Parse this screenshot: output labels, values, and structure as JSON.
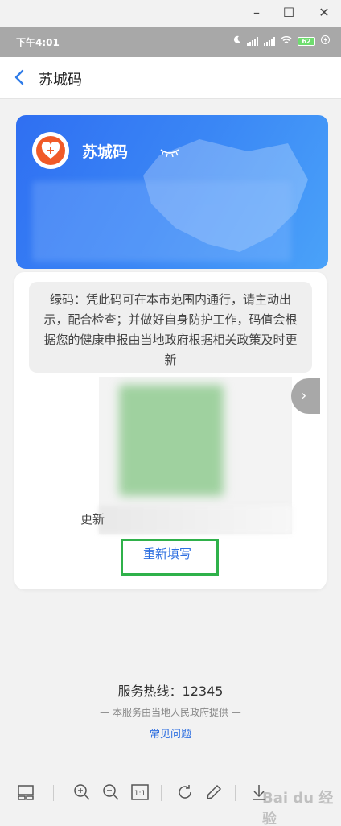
{
  "window": {
    "minimize_glyph": "–",
    "maximize_glyph": "☐",
    "close_glyph": "✕"
  },
  "status_bar": {
    "time": "下午4:01",
    "battery": "62"
  },
  "header": {
    "title": "苏城码",
    "back_icon": "back-chevron-icon"
  },
  "blue_card": {
    "title": "苏城码"
  },
  "notice": {
    "text": "绿码：凭此码可在本市范围内通行，请主动出示，配合检查；并做好自身防护工作，码值会根据您的健康申报由当地政府根据相关政策及时更新"
  },
  "qr_section": {
    "update_prefix": "更新",
    "next_glyph": "›"
  },
  "actions": {
    "refill_label": "重新填写"
  },
  "footer": {
    "hotline": "服务热线：12345",
    "provided_by": "— 本服务由当地人民政府提供 —",
    "faq": "常见问题"
  },
  "colors": {
    "blue_start": "#2f6ff2",
    "blue_end": "#4aa2f9",
    "accent_link": "#2e6fe0",
    "highlight_green": "#2fb14a",
    "logo_orange": "#f05a28"
  },
  "watermark": {
    "text": "Bai du 经验"
  },
  "toolbar": {
    "icons": [
      "layout-icon",
      "zoom-in-icon",
      "zoom-out-icon",
      "actual-size-icon",
      "rotate-icon",
      "pencil-icon",
      "download-icon"
    ],
    "actual_size_label": "1:1"
  }
}
